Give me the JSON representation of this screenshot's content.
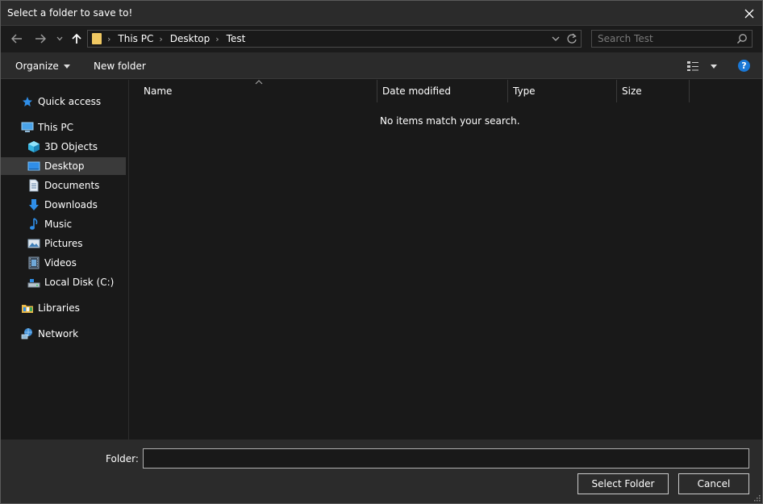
{
  "window": {
    "title": "Select a folder to save to!"
  },
  "navigation": {
    "breadcrumbs": [
      "This PC",
      "Desktop",
      "Test"
    ],
    "search": {
      "placeholder": "Search Test",
      "value": ""
    }
  },
  "toolbar": {
    "organize_label": "Organize",
    "new_folder_label": "New folder"
  },
  "sidebar": {
    "quick_access": "Quick access",
    "this_pc": "This PC",
    "items": [
      {
        "label": "3D Objects",
        "icon": "cube-icon"
      },
      {
        "label": "Desktop",
        "icon": "desktop-icon",
        "selected": true
      },
      {
        "label": "Documents",
        "icon": "document-icon"
      },
      {
        "label": "Downloads",
        "icon": "download-icon"
      },
      {
        "label": "Music",
        "icon": "music-icon"
      },
      {
        "label": "Pictures",
        "icon": "picture-icon"
      },
      {
        "label": "Videos",
        "icon": "video-icon"
      },
      {
        "label": "Local Disk (C:)",
        "icon": "drive-icon"
      }
    ],
    "libraries": "Libraries",
    "network": "Network"
  },
  "file_list": {
    "columns": [
      "Name",
      "Date modified",
      "Type",
      "Size"
    ],
    "empty_message": "No items match your search."
  },
  "footer": {
    "folder_label": "Folder:",
    "folder_value": "",
    "select_button": "Select Folder",
    "cancel_button": "Cancel"
  },
  "colors": {
    "background": "#191919",
    "chrome": "#2b2b2b",
    "selection": "#3a3a3a",
    "accent": "#1a78d6",
    "folder": "#f0c862"
  }
}
